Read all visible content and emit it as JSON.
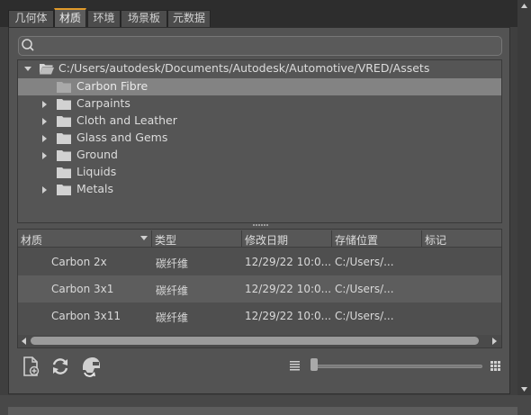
{
  "tabs": [
    {
      "label": "几何体",
      "active": false
    },
    {
      "label": "材质",
      "active": true
    },
    {
      "label": "环境",
      "active": false
    },
    {
      "label": "场景板",
      "active": false
    },
    {
      "label": "元数据",
      "active": false
    }
  ],
  "search": {
    "placeholder": "",
    "value": ""
  },
  "tree": {
    "root": "C:/Users/autodesk/Documents/Autodesk/Automotive/VRED/Assets",
    "items": [
      {
        "label": "Carbon Fibre",
        "expandable": false,
        "selected": true
      },
      {
        "label": "Carpaints",
        "expandable": true,
        "selected": false
      },
      {
        "label": "Cloth and Leather",
        "expandable": true,
        "selected": false
      },
      {
        "label": "Glass and Gems",
        "expandable": true,
        "selected": false
      },
      {
        "label": "Ground",
        "expandable": true,
        "selected": false
      },
      {
        "label": "Liquids",
        "expandable": false,
        "selected": false
      },
      {
        "label": "Metals",
        "expandable": true,
        "selected": false
      }
    ]
  },
  "table": {
    "columns": [
      "材质",
      "类型",
      "修改日期",
      "存储位置",
      "标记"
    ],
    "sorted_column": "材质",
    "rows": [
      {
        "name": "Carbon 2x",
        "type": "碳纤维",
        "date": "12/29/22 10:0...",
        "location": "C:/Users/...",
        "tag": ""
      },
      {
        "name": "Carbon 3x1",
        "type": "碳纤维",
        "date": "12/29/22 10:0...",
        "location": "C:/Users/...",
        "tag": ""
      },
      {
        "name": "Carbon 3x11",
        "type": "碳纤维",
        "date": "12/29/22 10:0...",
        "location": "C:/Users/...",
        "tag": ""
      }
    ]
  },
  "toolbar": {
    "icons": [
      "new-file-icon",
      "refresh-icon",
      "helmet-sync-icon"
    ],
    "view_list_icon": "list-view-icon",
    "view_grid_icon": "grid-view-icon",
    "thumbnail_size": 0.0
  },
  "colors": {
    "accent": "#e09a2a",
    "selection": "#838383"
  }
}
